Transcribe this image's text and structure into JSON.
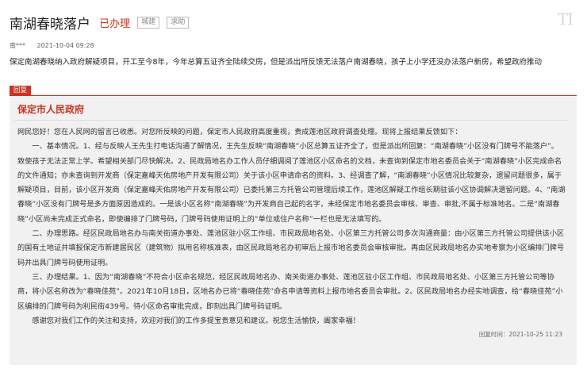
{
  "header": {
    "title": "南湖春晓落户",
    "status": "已办理",
    "tags": [
      "城建",
      "求助"
    ],
    "corner_icon": "text-size-icon"
  },
  "meta": {
    "user": "南***",
    "time": "2021-10-04 09:28"
  },
  "question": "保定南湖春晓纳入政府解疑项目，开工至今8年，今年总算五证齐全陆续交房，但是派出所反馈无法落户南湖春晓，孩子上小学还没办法落户新房，希望政府推动",
  "reply": {
    "badge": "回复",
    "org": "保定市人民政府",
    "greeting": "网民您好！您在人民网的留言已收悉。对您所反映的问题，保定市人民政府高度重视，责成莲池区政府调查处理。现将上报结果反馈如下：",
    "paragraphs": [
      "一、基本情况。1、经与反映人王先生打电话沟通了解情况，王先生反映“南湖春晓”小区总算五证齐全了，但是派出所回复：“南湖春晓”小区没有门牌号不能落户”。致使孩子无法正常上学。希望相关部门尽快解决。2、民政局地名办工作人员仔细调阅了莲池区小区命名的文档，未查询到保定市地名委员会关于“南湖春晓”小区完成命名的文件通知；亦未查询到开发商（保定嘉峰天佑房地产开发有限公司）关于该小区申请命名的资料。3、经调查了解，“南湖春晓”小区情况比较复杂，遗留问题很多，属于解疑项目，目前，该小区开发商（保定嘉峰天佑房地产开发有限公司）已委托第三方托管公司管理后续工作，莲池区解疑工作组长期驻该小区协调解决遗留问题。4、“南湖春晓”小区没有门牌号是多方面原因造成的。一是该小区名称“南湖春晓”为开发商自己起的名字，未经保定市地名委员会审核、审查、审批,不属于标准地名。二是“南湖春晓”小区尚未完成正式命名，即使编排了门牌号码，门牌号码使用证明上的“单位或住户名称”一栏也是无法填写的。",
      "二、办理思路。经区民政局地名办与南关街道办事处、莲池区驻小区工作组、市民政局地名处、小区第三方托管公司多次沟通商量：由小区第三方托管公司提供该小区的国有土地证并填报保定市新建居民区（建筑物）拟用名称核准表，由区民政局地名办初审后上报市地名委员会审核审批。再由区民政局地名办实地考察为小区编排门牌号码并出具门牌号码使用证明。",
      "三、办理结果。1、因为“南湖春晓”不符合小区命名规范，经区民政局地名办、南关街道办事处、莲池区驻小区工作组、市民政局地名处、小区第三方托管公司等协商，将小区名称改为“春晓佳苑”。2021年10月18日，区地名办已将“春晓佳苑”命名申请等资料上报市地名委员会审批。2、区民政局地名办经实地调查，给“春晓佳苑”小区编排的门牌号码为利民街439号。待小区命名审批完成，即刻出具门牌号码证明。",
      "感谢您对我们工作的关注和支持，欢迎对我们的工作多提宝贵意见和建议。祝您生活愉快，阖家幸福！"
    ],
    "time": "回复时间：2021-10-25 11:23"
  }
}
